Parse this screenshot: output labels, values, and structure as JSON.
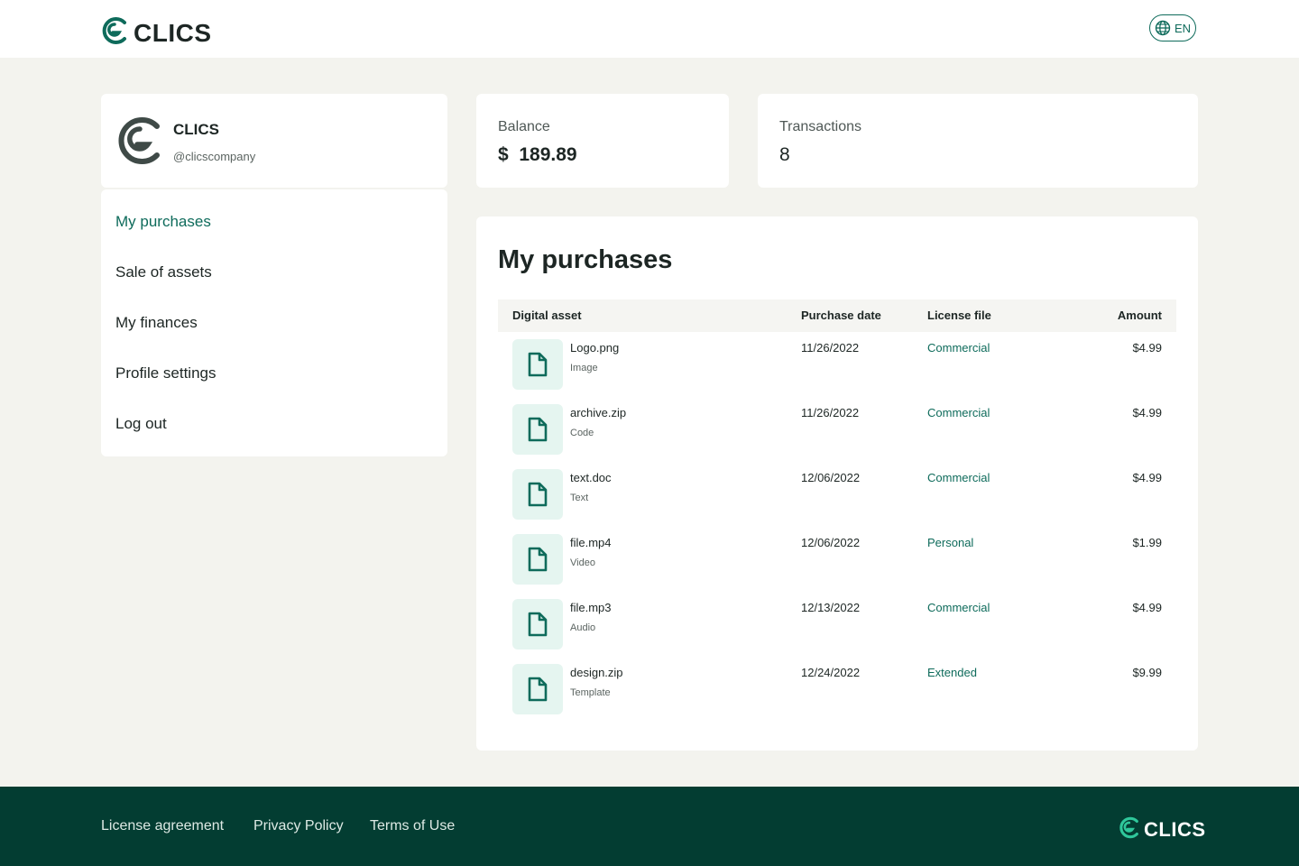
{
  "app": {
    "logo_text": "CLICS",
    "language": "EN"
  },
  "profile": {
    "name": "CLICS",
    "handle": "@clicscompany"
  },
  "menu": {
    "items": [
      {
        "label": "My purchases",
        "active": true
      },
      {
        "label": "Sale of assets",
        "active": false
      },
      {
        "label": "My finances",
        "active": false
      },
      {
        "label": "Profile settings",
        "active": false
      },
      {
        "label": "Log out",
        "active": false
      }
    ]
  },
  "stats": {
    "balance_label": "Balance",
    "balance_value": "$  189.89",
    "transactions_label": "Transactions",
    "transactions_value": "8"
  },
  "purchases": {
    "title": "My purchases",
    "columns": {
      "asset": "Digital asset",
      "date": "Purchase date",
      "license": "License file",
      "amount": "Amount"
    },
    "rows": [
      {
        "name": "Logo.png",
        "type": "Image",
        "date": "11/26/2022",
        "license": "Commercial",
        "amount": "$4.99",
        "icon": "file-icon"
      },
      {
        "name": "archive.zip",
        "type": "Code",
        "date": "11/26/2022",
        "license": "Commercial",
        "amount": "$4.99",
        "icon": "file-icon"
      },
      {
        "name": "text.doc",
        "type": "Text",
        "date": "12/06/2022",
        "license": "Commercial",
        "amount": "$4.99",
        "icon": "file-icon"
      },
      {
        "name": "file.mp4",
        "type": "Video",
        "date": "12/06/2022",
        "license": "Personal",
        "amount": "$1.99",
        "icon": "file-icon"
      },
      {
        "name": "file.mp3",
        "type": "Audio",
        "date": "12/13/2022",
        "license": "Commercial",
        "amount": "$4.99",
        "icon": "file-icon"
      },
      {
        "name": "design.zip",
        "type": "Template",
        "date": "12/24/2022",
        "license": "Extended",
        "amount": "$9.99",
        "icon": "file-icon"
      }
    ]
  },
  "footer": {
    "links": [
      "License agreement",
      "Privacy Policy",
      "Terms of Use"
    ],
    "logo_text": "CLICS"
  },
  "colors": {
    "brand_green": "#0e6b5b",
    "brand_accent": "#2fc79b",
    "footer_bg": "#033d32",
    "page_bg": "#f3f3ee",
    "tile_bg": "#e5f5f0"
  }
}
